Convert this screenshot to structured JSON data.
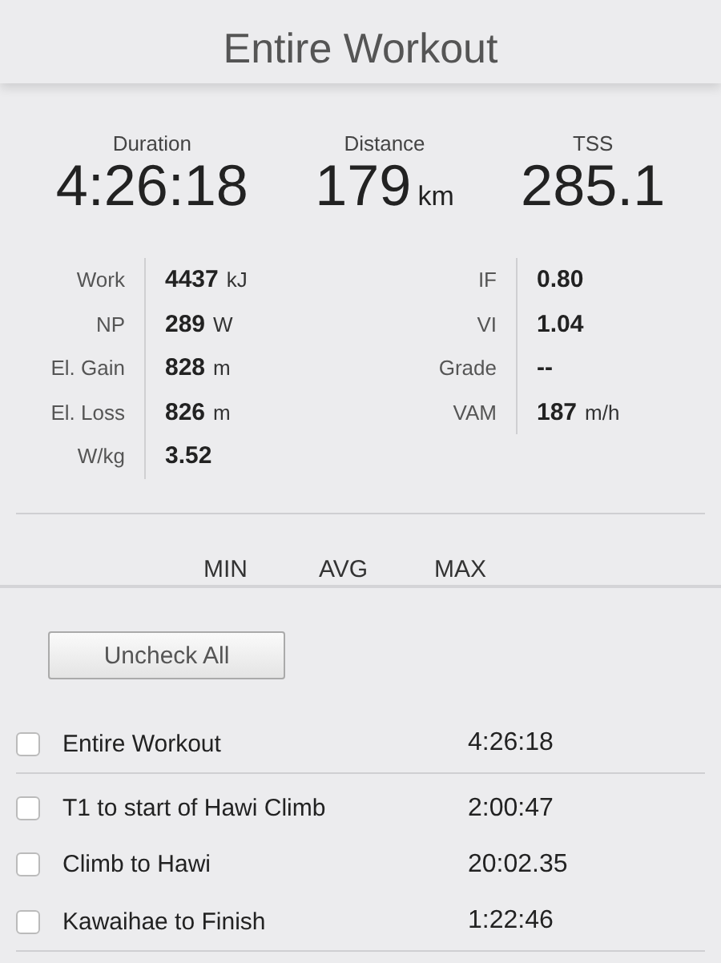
{
  "title": "Entire Workout",
  "summary": [
    {
      "label": "Duration",
      "value": "4:26:18"
    },
    {
      "label": "Distance",
      "value": "179",
      "unit": "km"
    },
    {
      "label": "TSS",
      "value": "285.1"
    }
  ],
  "stats_left": [
    {
      "label": "Work",
      "value": "4437",
      "unit": "kJ"
    },
    {
      "label": "NP",
      "value": "289",
      "unit": "W"
    },
    {
      "label": "El. Gain",
      "value": "828",
      "unit": "m"
    },
    {
      "label": "El. Loss",
      "value": "826",
      "unit": "m"
    },
    {
      "label": "W/kg",
      "value": "3.52"
    }
  ],
  "stats_right": [
    {
      "label": "IF",
      "value": "0.80"
    },
    {
      "label": "VI",
      "value": "1.04"
    },
    {
      "label": "Grade",
      "value": "--"
    },
    {
      "label": "VAM",
      "value": "187",
      "unit": "m/h"
    }
  ],
  "columns": [
    "MIN",
    "AVG",
    "MAX"
  ],
  "uncheck_button": "Uncheck All",
  "segments": [
    {
      "name": "Entire Workout",
      "time": "4:26:18",
      "checked": false,
      "divider_after": true
    },
    {
      "name": "T1 to start of Hawi Climb",
      "time": "2:00:47",
      "checked": false,
      "divider_after": false
    },
    {
      "name": "Climb to Hawi",
      "time": "20:02.35",
      "checked": false,
      "divider_after": false
    },
    {
      "name": "Kawaihae to Finish",
      "time": "1:22:46",
      "checked": false,
      "divider_after": true
    }
  ]
}
